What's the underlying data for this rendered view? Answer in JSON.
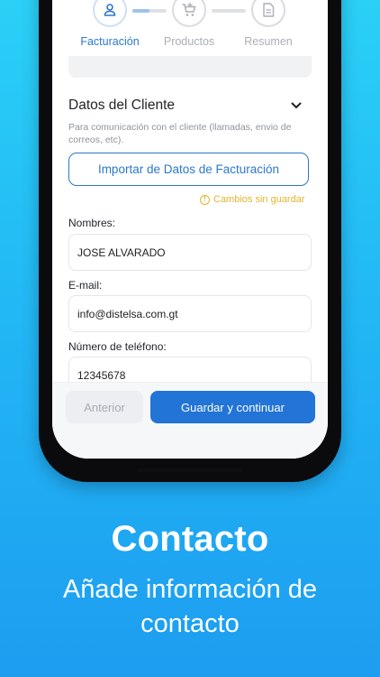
{
  "stepper": {
    "steps": [
      {
        "label": "Facturación",
        "icon": "user-icon",
        "active": true
      },
      {
        "label": "Productos",
        "icon": "cart-add-icon",
        "active": false
      },
      {
        "label": "Resumen",
        "icon": "document-icon",
        "active": false
      }
    ],
    "progress": [
      0.5,
      0
    ]
  },
  "section": {
    "title": "Datos del Cliente",
    "subtitle": "Para comunicación con el cliente (llamadas, envio de correos, etc)."
  },
  "import_button": "Importar de Datos de Facturación",
  "unsaved_notice": "Cambios sin guardar",
  "fields": [
    {
      "label": "Nombres:",
      "value": "JOSE ALVARADO"
    },
    {
      "label": "E-mail:",
      "value": "info@distelsa.com.gt"
    },
    {
      "label": "Número de teléfono:",
      "value": "12345678"
    }
  ],
  "buttons": {
    "previous": "Anterior",
    "save_continue": "Guardar y continuar"
  },
  "promo": {
    "headline": "Contacto",
    "subline": "Añade información de contacto"
  },
  "colors": {
    "accent": "#2274d6",
    "accent_text": "#2c78c8",
    "warning": "#e3b52c",
    "background_top": "#2ad0f6",
    "background_bottom": "#1d9df0"
  }
}
